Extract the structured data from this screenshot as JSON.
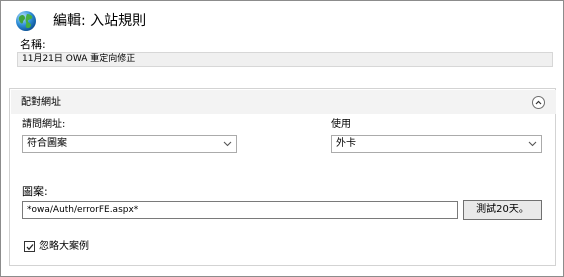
{
  "dialog": {
    "title": "編輯: 入站規則",
    "name_label": "名稱:",
    "name_value": "11月21日 OWA 重定向修正"
  },
  "match_url": {
    "section_title": "配對網址",
    "requested_url_label": "請問網址:",
    "requested_url_value": "符合圖案",
    "using_label": "使用",
    "using_value": "外卡",
    "pattern_label": "圖案:",
    "pattern_value": "*owa/Auth/errorFE.aspx*",
    "test_button_label": "測試20天。",
    "ignore_case_label": "忽略大案例",
    "ignore_case_checked": true
  },
  "colors": {
    "header_bg": "#f3f3f3",
    "field_readonly_bg": "#f0f0f0"
  },
  "icons": [
    "globe-icon",
    "chevron-up-icon",
    "dropdown-arrow-icon",
    "checkmark-icon"
  ]
}
